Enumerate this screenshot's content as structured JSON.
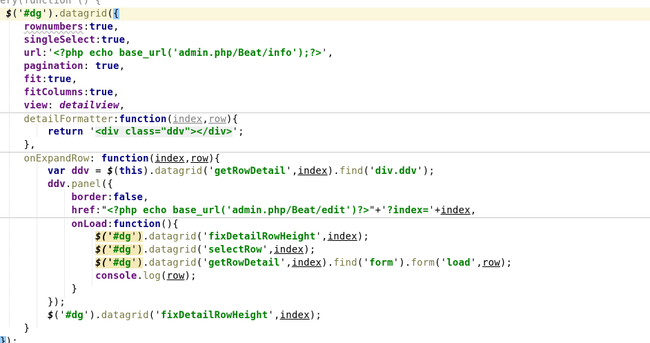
{
  "editor": {
    "language": "javascript",
    "colors": {
      "background": "#ffffff",
      "keyword": "#000080",
      "string": "#008000",
      "property": "#660e7a",
      "function_call": "#7a7a43",
      "param": "#808080",
      "brace_match": "#99ccff",
      "dg_highlight": "#f5e9b8",
      "line_highlight": "#fbf7dd"
    },
    "lines": [
      {
        "tokens": [
          {
            "t": "ery(function () {",
            "c": "tok-gray"
          }
        ]
      },
      {
        "tokens": [
          {
            "t": " $",
            "c": "tok-dollar"
          },
          {
            "t": "('",
            "c": "tok-punct"
          },
          {
            "t": "#dg",
            "c": "tok-str"
          },
          {
            "t": "').",
            "c": "tok-punct"
          },
          {
            "t": "datagrid",
            "c": "tok-fn"
          },
          {
            "t": "(",
            "c": "tok-punct"
          },
          {
            "t": "{",
            "c": "tok-punct sel-brace"
          }
        ]
      },
      {
        "tokens": [
          {
            "t": "    ",
            "c": ""
          },
          {
            "t": "rownumbers",
            "c": "tok-prop tok-wavy"
          },
          {
            "t": ":",
            "c": "tok-punct"
          },
          {
            "t": "true",
            "c": "tok-kw"
          },
          {
            "t": ",",
            "c": "tok-punct"
          }
        ]
      },
      {
        "tokens": [
          {
            "t": "    ",
            "c": ""
          },
          {
            "t": "singleSelect",
            "c": "tok-prop"
          },
          {
            "t": ":",
            "c": "tok-punct"
          },
          {
            "t": "true",
            "c": "tok-kw"
          },
          {
            "t": ",",
            "c": "tok-punct"
          }
        ]
      },
      {
        "tokens": [
          {
            "t": "    ",
            "c": ""
          },
          {
            "t": "url",
            "c": "tok-prop"
          },
          {
            "t": ":'",
            "c": "tok-punct"
          },
          {
            "t": "<?php echo base_url('admin.php/Beat/info');?>",
            "c": "tok-str"
          },
          {
            "t": "',",
            "c": "tok-punct"
          }
        ]
      },
      {
        "tokens": [
          {
            "t": "    ",
            "c": ""
          },
          {
            "t": "pagination",
            "c": "tok-prop"
          },
          {
            "t": ": ",
            "c": "tok-punct"
          },
          {
            "t": "true",
            "c": "tok-kw"
          },
          {
            "t": ",",
            "c": "tok-punct"
          }
        ]
      },
      {
        "tokens": [
          {
            "t": "    ",
            "c": ""
          },
          {
            "t": "fit",
            "c": "tok-prop"
          },
          {
            "t": ":",
            "c": "tok-punct"
          },
          {
            "t": "true",
            "c": "tok-kw"
          },
          {
            "t": ",",
            "c": "tok-punct"
          }
        ]
      },
      {
        "tokens": [
          {
            "t": "    ",
            "c": ""
          },
          {
            "t": "fitColumns",
            "c": "tok-prop"
          },
          {
            "t": ":",
            "c": "tok-punct"
          },
          {
            "t": "true",
            "c": "tok-kw"
          },
          {
            "t": ",",
            "c": "tok-punct"
          }
        ]
      },
      {
        "tokens": [
          {
            "t": "    ",
            "c": ""
          },
          {
            "t": "view",
            "c": "tok-prop"
          },
          {
            "t": ": ",
            "c": "tok-punct"
          },
          {
            "t": "detailview",
            "c": "tok-view"
          },
          {
            "t": ",",
            "c": "tok-punct"
          }
        ]
      },
      {
        "tokens": [
          {
            "t": "    ",
            "c": ""
          },
          {
            "t": "detailFormatter",
            "c": "tok-fn"
          },
          {
            "t": ":",
            "c": "tok-punct"
          },
          {
            "t": "function",
            "c": "tok-kw"
          },
          {
            "t": "(",
            "c": "tok-punct"
          },
          {
            "t": "index",
            "c": "tok-param"
          },
          {
            "t": ",",
            "c": "tok-punct"
          },
          {
            "t": "row",
            "c": "tok-param"
          },
          {
            "t": "){",
            "c": "tok-punct"
          }
        ]
      },
      {
        "tokens": [
          {
            "t": "        ",
            "c": ""
          },
          {
            "t": "return",
            "c": "tok-kw"
          },
          {
            "t": " '",
            "c": "tok-punct"
          },
          {
            "t": "<div class=\"ddv\"></div>",
            "c": "tok-str sel-gray-bg"
          },
          {
            "t": "';",
            "c": "tok-punct"
          }
        ]
      },
      {
        "tokens": [
          {
            "t": "    ",
            "c": ""
          },
          {
            "t": "},",
            "c": "tok-punct"
          }
        ]
      },
      {
        "tokens": [
          {
            "t": "    ",
            "c": ""
          },
          {
            "t": "onExpandRow",
            "c": "tok-fn"
          },
          {
            "t": ": ",
            "c": "tok-punct"
          },
          {
            "t": "function",
            "c": "tok-kw"
          },
          {
            "t": "(",
            "c": "tok-punct"
          },
          {
            "t": "index",
            "c": "tok-param-dark"
          },
          {
            "t": ",",
            "c": "tok-punct"
          },
          {
            "t": "row",
            "c": "tok-param-dark"
          },
          {
            "t": "){",
            "c": "tok-punct"
          }
        ]
      },
      {
        "tokens": [
          {
            "t": "        ",
            "c": ""
          },
          {
            "t": "var",
            "c": "tok-kw"
          },
          {
            "t": " ",
            "c": ""
          },
          {
            "t": "ddv",
            "c": "tok-prop"
          },
          {
            "t": " = ",
            "c": "tok-punct"
          },
          {
            "t": "$",
            "c": "tok-dollar"
          },
          {
            "t": "(",
            "c": "tok-punct"
          },
          {
            "t": "this",
            "c": "tok-kw"
          },
          {
            "t": ").",
            "c": "tok-punct"
          },
          {
            "t": "datagrid",
            "c": "tok-fn"
          },
          {
            "t": "('",
            "c": "tok-punct"
          },
          {
            "t": "getRowDetail",
            "c": "tok-str"
          },
          {
            "t": "',",
            "c": "tok-punct"
          },
          {
            "t": "index",
            "c": "tok-param-dark"
          },
          {
            "t": ").",
            "c": "tok-punct"
          },
          {
            "t": "find",
            "c": "tok-fn"
          },
          {
            "t": "('",
            "c": "tok-punct"
          },
          {
            "t": "div.ddv",
            "c": "tok-str"
          },
          {
            "t": "');",
            "c": "tok-punct"
          }
        ]
      },
      {
        "tokens": [
          {
            "t": "        ",
            "c": ""
          },
          {
            "t": "ddv",
            "c": "tok-prop"
          },
          {
            "t": ".",
            "c": "tok-punct"
          },
          {
            "t": "panel",
            "c": "tok-fn"
          },
          {
            "t": "({",
            "c": "tok-punct"
          }
        ]
      },
      {
        "tokens": [
          {
            "t": "            ",
            "c": ""
          },
          {
            "t": "border",
            "c": "tok-prop"
          },
          {
            "t": ":",
            "c": "tok-punct"
          },
          {
            "t": "false",
            "c": "tok-kw"
          },
          {
            "t": ",",
            "c": "tok-punct"
          }
        ]
      },
      {
        "tokens": [
          {
            "t": "            ",
            "c": ""
          },
          {
            "t": "href",
            "c": "tok-prop"
          },
          {
            "t": ":\"",
            "c": "tok-punct"
          },
          {
            "t": "<?php echo base_url('admin.php/Beat/edit')?>",
            "c": "tok-str"
          },
          {
            "t": "\"+'",
            "c": "tok-punct"
          },
          {
            "t": "?index=",
            "c": "tok-str"
          },
          {
            "t": "'+",
            "c": "tok-punct"
          },
          {
            "t": "index",
            "c": "tok-param-dark"
          },
          {
            "t": ",",
            "c": "tok-punct"
          }
        ]
      },
      {
        "tokens": [
          {
            "t": "            ",
            "c": ""
          },
          {
            "t": "onLoad",
            "c": "tok-prop"
          },
          {
            "t": ":",
            "c": "tok-punct"
          },
          {
            "t": "function",
            "c": "tok-kw"
          },
          {
            "t": "(){",
            "c": "tok-punct"
          }
        ]
      },
      {
        "tokens": [
          {
            "t": "                ",
            "c": ""
          },
          {
            "t": "$('",
            "c": "tok-dollar sel-dg"
          },
          {
            "t": "#dg",
            "c": "tok-str sel-dg"
          },
          {
            "t": "')",
            "c": "tok-punct sel-dg"
          },
          {
            "t": ".",
            "c": "tok-punct"
          },
          {
            "t": "datagrid",
            "c": "tok-fn"
          },
          {
            "t": "('",
            "c": "tok-punct"
          },
          {
            "t": "fixDetailRowHeight",
            "c": "tok-str"
          },
          {
            "t": "',",
            "c": "tok-punct"
          },
          {
            "t": "index",
            "c": "tok-param-dark"
          },
          {
            "t": ");",
            "c": "tok-punct"
          }
        ]
      },
      {
        "tokens": [
          {
            "t": "                ",
            "c": ""
          },
          {
            "t": "$('",
            "c": "tok-dollar sel-dg"
          },
          {
            "t": "#dg",
            "c": "tok-str sel-dg"
          },
          {
            "t": "')",
            "c": "tok-punct sel-dg"
          },
          {
            "t": ".",
            "c": "tok-punct"
          },
          {
            "t": "datagrid",
            "c": "tok-fn"
          },
          {
            "t": "('",
            "c": "tok-punct"
          },
          {
            "t": "selectRow",
            "c": "tok-str"
          },
          {
            "t": "',",
            "c": "tok-punct"
          },
          {
            "t": "index",
            "c": "tok-param-dark"
          },
          {
            "t": ");",
            "c": "tok-punct"
          }
        ]
      },
      {
        "tokens": [
          {
            "t": "                ",
            "c": ""
          },
          {
            "t": "$('",
            "c": "tok-dollar sel-dg"
          },
          {
            "t": "#dg",
            "c": "tok-str sel-dg"
          },
          {
            "t": "')",
            "c": "tok-punct sel-dg"
          },
          {
            "t": ".",
            "c": "tok-punct"
          },
          {
            "t": "datagrid",
            "c": "tok-fn"
          },
          {
            "t": "('",
            "c": "tok-punct"
          },
          {
            "t": "getRowDetail",
            "c": "tok-str"
          },
          {
            "t": "',",
            "c": "tok-punct"
          },
          {
            "t": "index",
            "c": "tok-param-dark"
          },
          {
            "t": ").",
            "c": "tok-punct"
          },
          {
            "t": "find",
            "c": "tok-fn"
          },
          {
            "t": "('",
            "c": "tok-punct"
          },
          {
            "t": "form",
            "c": "tok-str"
          },
          {
            "t": "').",
            "c": "tok-punct"
          },
          {
            "t": "form",
            "c": "tok-fn"
          },
          {
            "t": "('",
            "c": "tok-punct"
          },
          {
            "t": "load",
            "c": "tok-str"
          },
          {
            "t": "',",
            "c": "tok-punct"
          },
          {
            "t": "row",
            "c": "tok-param-dark"
          },
          {
            "t": ");",
            "c": "tok-punct"
          }
        ]
      },
      {
        "tokens": [
          {
            "t": "                ",
            "c": ""
          },
          {
            "t": "console",
            "c": "tok-prop"
          },
          {
            "t": ".",
            "c": "tok-punct"
          },
          {
            "t": "log",
            "c": "tok-fn"
          },
          {
            "t": "(",
            "c": "tok-punct"
          },
          {
            "t": "row",
            "c": "tok-param-dark"
          },
          {
            "t": ");",
            "c": "tok-punct"
          }
        ]
      },
      {
        "tokens": [
          {
            "t": "            ",
            "c": ""
          },
          {
            "t": "}",
            "c": "tok-punct"
          }
        ]
      },
      {
        "tokens": [
          {
            "t": "        ",
            "c": ""
          },
          {
            "t": "});",
            "c": "tok-punct"
          }
        ]
      },
      {
        "tokens": [
          {
            "t": "        ",
            "c": ""
          },
          {
            "t": "$",
            "c": "tok-dollar"
          },
          {
            "t": "('",
            "c": "tok-punct"
          },
          {
            "t": "#dg",
            "c": "tok-str"
          },
          {
            "t": "').",
            "c": "tok-punct"
          },
          {
            "t": "datagrid",
            "c": "tok-fn"
          },
          {
            "t": "('",
            "c": "tok-punct"
          },
          {
            "t": "fixDetailRowHeight",
            "c": "tok-str"
          },
          {
            "t": "',",
            "c": "tok-punct"
          },
          {
            "t": "index",
            "c": "tok-param-dark"
          },
          {
            "t": ");",
            "c": "tok-punct"
          }
        ]
      },
      {
        "tokens": [
          {
            "t": "    ",
            "c": ""
          },
          {
            "t": "}",
            "c": "tok-punct"
          }
        ]
      },
      {
        "tokens": [
          {
            "t": "}",
            "c": "tok-punct sel-brace"
          },
          {
            "t": ");",
            "c": "tok-punct"
          }
        ]
      }
    ]
  }
}
